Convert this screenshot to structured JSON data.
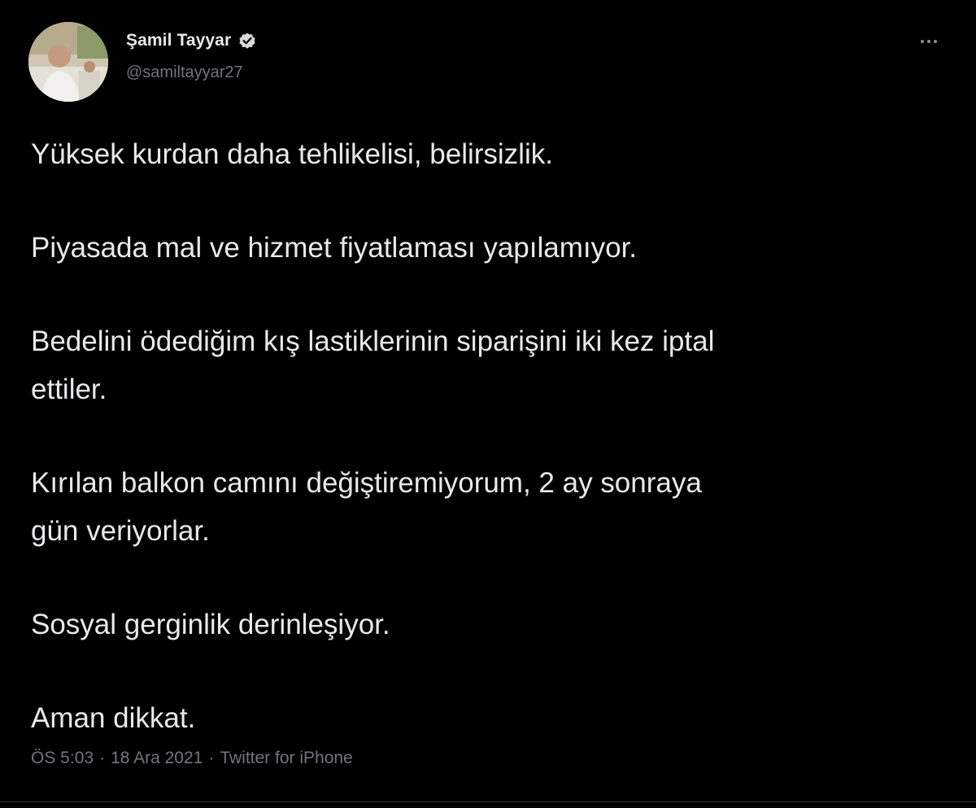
{
  "tweet": {
    "author": {
      "display_name": "Şamil Tayyar",
      "handle": "@samiltayyar27",
      "verified": true,
      "avatar_icon": "profile-photo"
    },
    "more_icon": "more-horizontal-icon",
    "paragraphs": [
      "Yüksek kurdan daha tehlikelisi, belirsizlik.",
      "Piyasada mal ve hizmet fiyatlaması yapılamıyor.",
      "Bedelini ödediğim kış lastiklerinin siparişini iki kez iptal\nettiler.",
      "Kırılan balkon camını değiştiremiyorum, 2 ay sonraya\ngün veriyorlar.",
      "Sosyal gerginlik derinleşiyor.",
      "Aman dikkat."
    ],
    "meta": {
      "time": "ÖS 5:03",
      "separator": "·",
      "date": "18 Ara 2021",
      "source": "Twitter for iPhone"
    }
  },
  "colors": {
    "background": "#000000",
    "primary_text": "#e7e9ea",
    "secondary_text": "#71767b",
    "verified_badge": "#d9d9d9"
  }
}
